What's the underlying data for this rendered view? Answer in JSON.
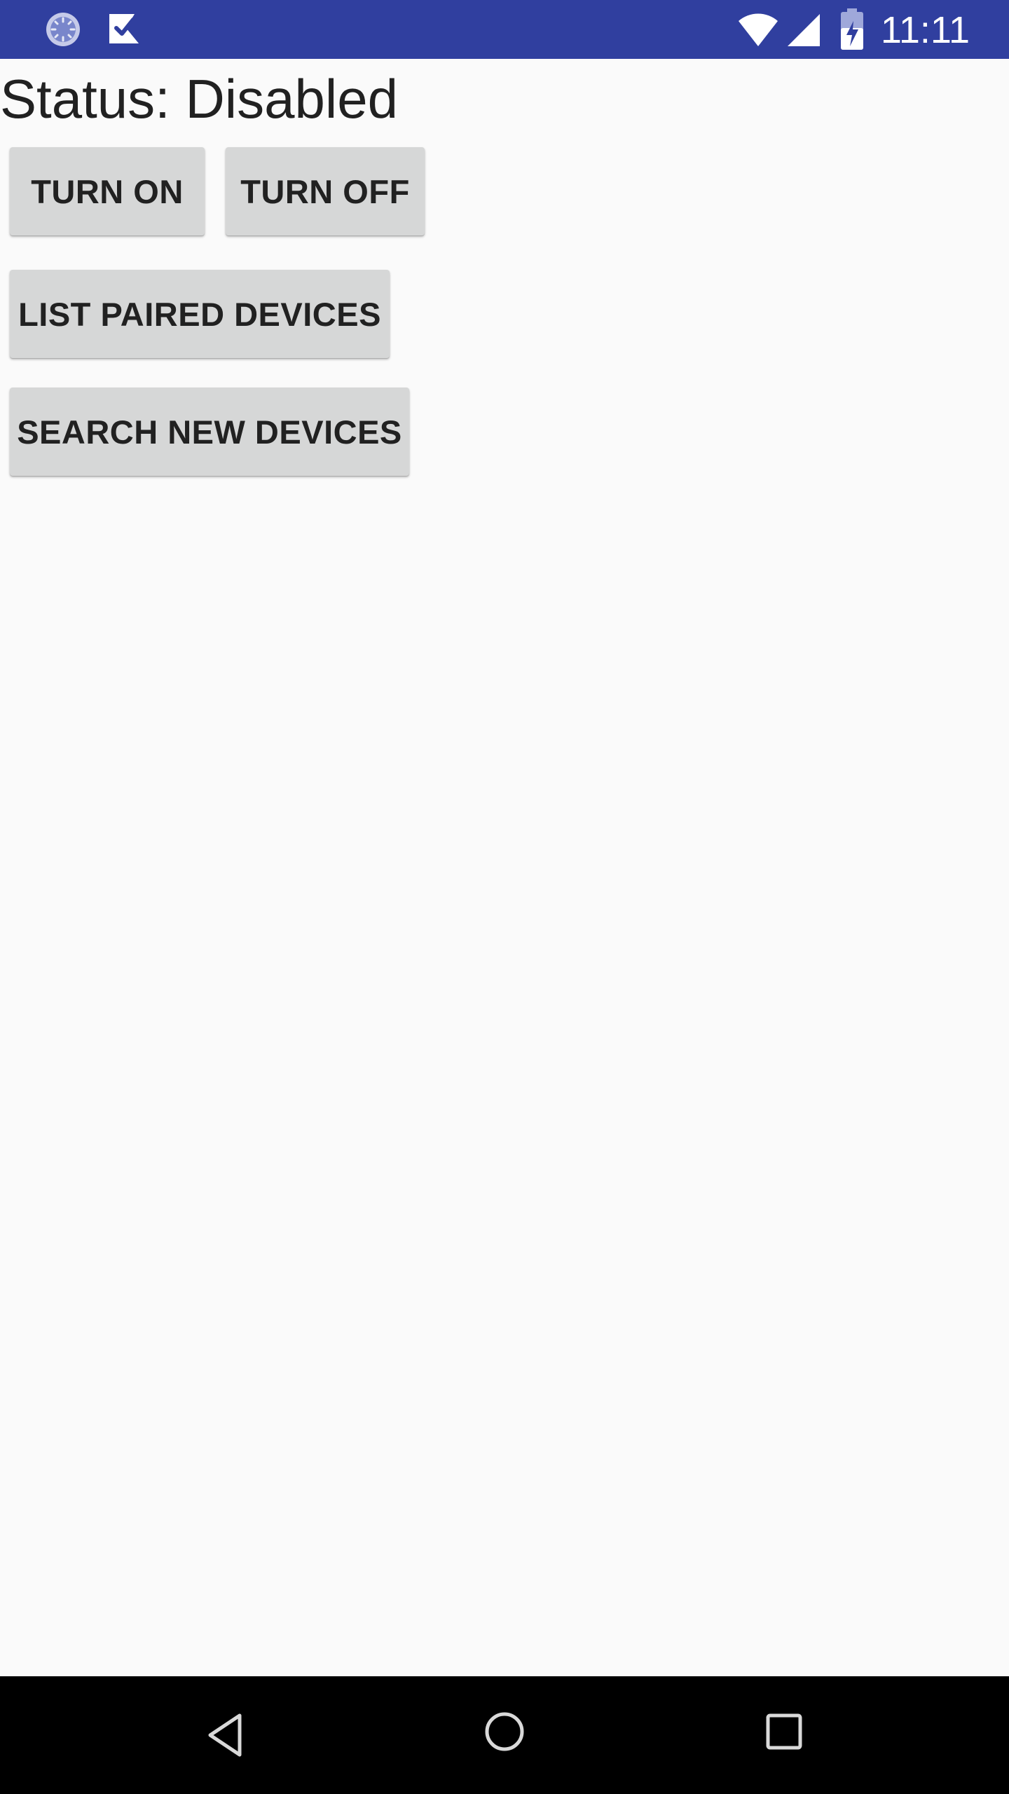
{
  "status_bar": {
    "time": "11:11",
    "icons": [
      "sync-icon",
      "task-check-icon",
      "wifi-icon",
      "cell-signal-icon",
      "battery-charging-icon"
    ],
    "background_color": "#303f9f"
  },
  "main": {
    "status_text": "Status: Disabled",
    "buttons": {
      "turn_on": "TURN ON",
      "turn_off": "TURN OFF",
      "list_paired": "LIST PAIRED DEVICES",
      "search_new": "SEARCH NEW DEVICES"
    }
  },
  "nav_bar": {
    "icons": [
      "back-icon",
      "home-icon",
      "recents-icon"
    ]
  }
}
